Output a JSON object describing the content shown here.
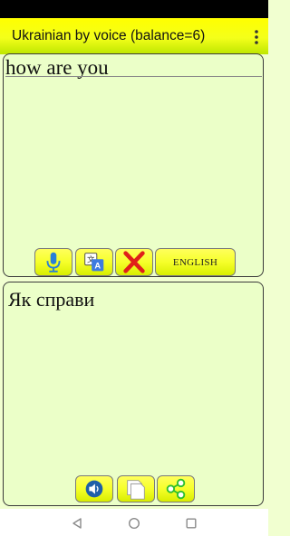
{
  "app": {
    "title": "Ukrainian by voice (balance=6)"
  },
  "input_panel": {
    "text": "how are you",
    "language_button_label": "ENGLISH"
  },
  "output_panel": {
    "text": "Як справи"
  },
  "icons": {
    "menu": "more-vert-icon",
    "microphone": "microphone-icon",
    "translate": "translate-icon",
    "clear": "close-x-icon",
    "speaker": "speaker-icon",
    "copy": "copy-icon",
    "share": "share-icon",
    "nav_back": "back-triangle-icon",
    "nav_home": "home-circle-icon",
    "nav_recents": "recents-square-icon"
  },
  "colors": {
    "app_bar": "#ffff00",
    "panel_background": "#ebffc8",
    "button_yellow": "#f6ff2a",
    "clear_red": "#e0201a",
    "mic_blue": "#2a7fd6",
    "share_green": "#2fbf2f"
  }
}
